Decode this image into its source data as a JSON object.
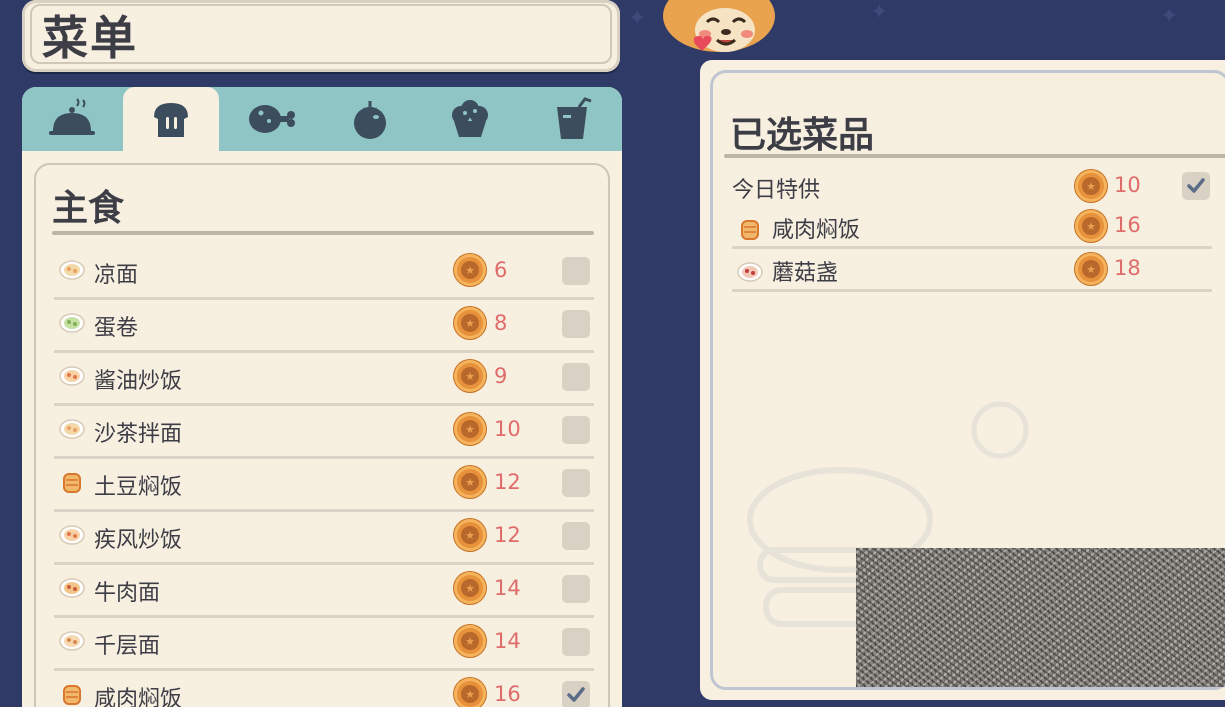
{
  "menu": {
    "title": "菜单"
  },
  "tabs": [
    {
      "icon": "cloche-icon",
      "active": false
    },
    {
      "icon": "bread-icon",
      "active": true
    },
    {
      "icon": "meat-icon",
      "active": false
    },
    {
      "icon": "tomato-icon",
      "active": false
    },
    {
      "icon": "muffin-icon",
      "active": false
    },
    {
      "icon": "drink-icon",
      "active": false
    }
  ],
  "category": {
    "title": "主食"
  },
  "items": [
    {
      "name": "凉面",
      "price": "6",
      "checked": false,
      "icon": "noodle-icon"
    },
    {
      "name": "蛋卷",
      "price": "8",
      "checked": false,
      "icon": "egg-roll-icon"
    },
    {
      "name": "酱油炒饭",
      "price": "9",
      "checked": false,
      "icon": "fried-rice-icon"
    },
    {
      "name": "沙茶拌面",
      "price": "10",
      "checked": false,
      "icon": "noodle-icon"
    },
    {
      "name": "土豆焖饭",
      "price": "12",
      "checked": false,
      "icon": "rice-bowl-icon"
    },
    {
      "name": "疾风炒饭",
      "price": "12",
      "checked": false,
      "icon": "fried-rice-icon"
    },
    {
      "name": "牛肉面",
      "price": "14",
      "checked": false,
      "icon": "beef-noodle-icon"
    },
    {
      "name": "千层面",
      "price": "14",
      "checked": false,
      "icon": "lasagna-icon"
    },
    {
      "name": "咸肉焖饭",
      "price": "16",
      "checked": true,
      "icon": "rice-bowl-icon"
    }
  ],
  "selected": {
    "title": "已选菜品",
    "items": [
      {
        "name": "今日特供",
        "price": "10",
        "checked": true,
        "icon": ""
      },
      {
        "name": "咸肉焖饭",
        "price": "16",
        "icon": "rice-bowl-icon"
      },
      {
        "name": "蘑菇盏",
        "price": "18",
        "icon": "mushroom-dish-icon"
      }
    ]
  },
  "colors": {
    "background": "#2f3a66",
    "panel": "#f7efe0",
    "tab_bar": "#8fc5c4",
    "tab_icon": "#3c4d5e",
    "coin": "#e7913a",
    "price": "#e06b6b",
    "check": "#5a6c86"
  }
}
